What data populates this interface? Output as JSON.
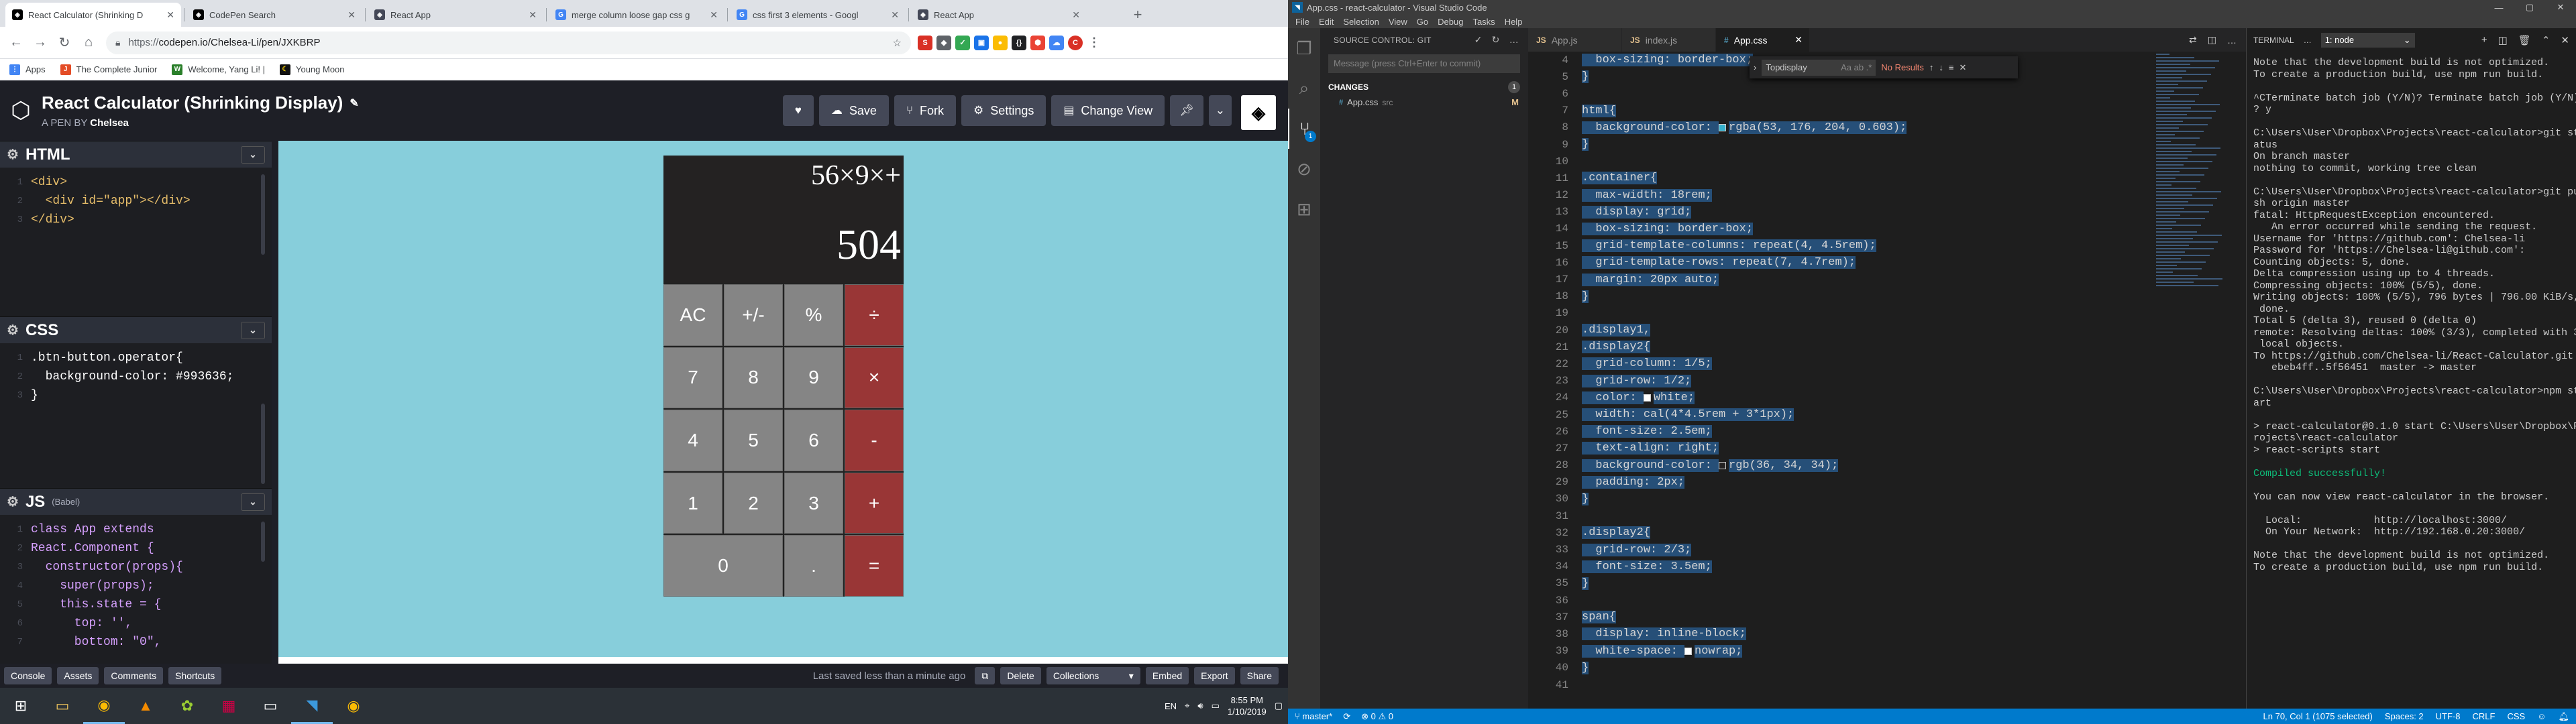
{
  "chrome": {
    "tabs": [
      {
        "title": "React Calculator (Shrinking D",
        "icon": "codepen-icon",
        "color": "#000000"
      },
      {
        "title": "CodePen Search",
        "icon": "codepen-icon",
        "color": "#000000"
      },
      {
        "title": "React App",
        "icon": "codepen-icon",
        "color": "#444857"
      },
      {
        "title": "merge column loose gap css g",
        "icon": "google-icon",
        "color": "#4285f4"
      },
      {
        "title": "css first 3 elements - Googl",
        "icon": "google-icon",
        "color": "#4285f4"
      },
      {
        "title": "React App",
        "icon": "codepen-icon",
        "color": "#444857"
      }
    ],
    "address": "https://codepen.io/Chelsea-Li/pen/JXKBRP",
    "address_domain": "https://",
    "address_rest": "codepen.io/Chelsea-Li/pen/JXKBRP",
    "bookmarks": [
      "Apps",
      "The Complete Junior",
      "Welcome, Yang Li! |",
      "Young Moon"
    ]
  },
  "codepen": {
    "title": "React Calculator (Shrinking Display)",
    "by_prefix": "A PEN BY",
    "author": "Chelsea",
    "buttons": {
      "save": "Save",
      "fork": "Fork",
      "settings": "Settings",
      "change_view": "Change View"
    },
    "html_label": "HTML",
    "css_label": "CSS",
    "js_label": "JS",
    "js_sub": "(Babel)",
    "html_lines": [
      "<div>",
      "  <div id=\"app\"></div>",
      "</div>"
    ],
    "css_lines": [
      ".btn-button.operator{",
      "  background-color: #993636;",
      "}"
    ],
    "js_lines": [
      "class App extends",
      "React.Component {",
      "  constructor(props){",
      "    super(props);",
      "    this.state = {",
      "      top: '',",
      "      bottom: \"0\","
    ],
    "calc": {
      "display_top": "56×9×+",
      "display_bottom": "504",
      "keys": [
        {
          "l": "AC",
          "op": false
        },
        {
          "l": "+/-",
          "op": false
        },
        {
          "l": "%",
          "op": false
        },
        {
          "l": "÷",
          "op": true
        },
        {
          "l": "7",
          "op": false
        },
        {
          "l": "8",
          "op": false
        },
        {
          "l": "9",
          "op": false
        },
        {
          "l": "×",
          "op": true
        },
        {
          "l": "4",
          "op": false
        },
        {
          "l": "5",
          "op": false
        },
        {
          "l": "6",
          "op": false
        },
        {
          "l": "-",
          "op": true
        },
        {
          "l": "1",
          "op": false
        },
        {
          "l": "2",
          "op": false
        },
        {
          "l": "3",
          "op": false
        },
        {
          "l": "+",
          "op": true
        },
        {
          "l": "0",
          "op": false
        },
        {
          "l": ".",
          "op": false
        },
        {
          "l": "=",
          "op": true
        }
      ]
    },
    "footer": {
      "console": "Console",
      "assets": "Assets",
      "comments": "Comments",
      "shortcuts": "Shortcuts",
      "saved": "Last saved less than a minute ago",
      "delete": "Delete",
      "collections": "Collections",
      "embed": "Embed",
      "export": "Export",
      "share": "Share"
    }
  },
  "taskbar": {
    "lang": "EN",
    "time": "8:55 PM",
    "date": "1/10/2019"
  },
  "vscode": {
    "title": "App.css - react-calculator - Visual Studio Code",
    "menu": [
      "File",
      "Edit",
      "Selection",
      "View",
      "Go",
      "Debug",
      "Tasks",
      "Help"
    ],
    "scm": {
      "header": "SOURCE CONTROL: GIT",
      "placeholder": "Message (press Ctrl+Enter to commit)",
      "changes": "CHANGES",
      "count": "1",
      "file": "App.css",
      "dir": "src",
      "status": "M"
    },
    "tabs": [
      "App.js",
      "index.js",
      "App.css"
    ],
    "find": {
      "value": "Topdisplay",
      "result": "No Results"
    },
    "code": [
      {
        "n": "4",
        "t": "  box-sizing: border-box;"
      },
      {
        "n": "5",
        "t": "}"
      },
      {
        "n": "6",
        "t": ""
      },
      {
        "n": "7",
        "t": "html{"
      },
      {
        "n": "8",
        "t": "  background-color: rgba(53, 176, 204, 0.603);"
      },
      {
        "n": "9",
        "t": "}"
      },
      {
        "n": "10",
        "t": ""
      },
      {
        "n": "11",
        "t": ".container{"
      },
      {
        "n": "12",
        "t": "  max-width: 18rem;"
      },
      {
        "n": "13",
        "t": "  display: grid;"
      },
      {
        "n": "14",
        "t": "  box-sizing: border-box;"
      },
      {
        "n": "15",
        "t": "  grid-template-columns: repeat(4, 4.5rem);"
      },
      {
        "n": "16",
        "t": "  grid-template-rows: repeat(7, 4.7rem);"
      },
      {
        "n": "17",
        "t": "  margin: 20px auto;"
      },
      {
        "n": "18",
        "t": "}"
      },
      {
        "n": "19",
        "t": ""
      },
      {
        "n": "20",
        "t": ".display1,"
      },
      {
        "n": "21",
        "t": ".display2{"
      },
      {
        "n": "22",
        "t": "  grid-column: 1/5;"
      },
      {
        "n": "23",
        "t": "  grid-row: 1/2;"
      },
      {
        "n": "24",
        "t": "  color: white;"
      },
      {
        "n": "25",
        "t": "  width: cal(4*4.5rem + 3*1px);"
      },
      {
        "n": "26",
        "t": "  font-size: 2.5em;"
      },
      {
        "n": "27",
        "t": "  text-align: right;"
      },
      {
        "n": "28",
        "t": "  background-color: rgb(36, 34, 34);"
      },
      {
        "n": "29",
        "t": "  padding: 2px;"
      },
      {
        "n": "30",
        "t": "}"
      },
      {
        "n": "31",
        "t": ""
      },
      {
        "n": "32",
        "t": ".display2{"
      },
      {
        "n": "33",
        "t": "  grid-row: 2/3;"
      },
      {
        "n": "34",
        "t": "  font-size: 3.5em;"
      },
      {
        "n": "35",
        "t": "}"
      },
      {
        "n": "36",
        "t": ""
      },
      {
        "n": "37",
        "t": "span{"
      },
      {
        "n": "38",
        "t": "  display: inline-block;"
      },
      {
        "n": "39",
        "t": "  white-space: nowrap;"
      },
      {
        "n": "40",
        "t": "}"
      },
      {
        "n": "41",
        "t": ""
      }
    ],
    "terminal": {
      "label": "TERMINAL",
      "select": "1: node",
      "lines": [
        "Note that the development build is not optimized.",
        "To create a production build, use npm run build.",
        "",
        "^CTerminate batch job (Y/N)? Terminate batch job (Y/N)",
        "? y",
        "",
        "C:\\Users\\User\\Dropbox\\Projects\\react-calculator>git st",
        "atus",
        "On branch master",
        "nothing to commit, working tree clean",
        "",
        "C:\\Users\\User\\Dropbox\\Projects\\react-calculator>git pu",
        "sh origin master",
        "fatal: HttpRequestException encountered.",
        "   An error occurred while sending the request.",
        "Username for 'https://github.com': Chelsea-li",
        "Password for 'https://Chelsea-li@github.com':",
        "Counting objects: 5, done.",
        "Delta compression using up to 4 threads.",
        "Compressing objects: 100% (5/5), done.",
        "Writing objects: 100% (5/5), 796 bytes | 796.00 KiB/s,",
        " done.",
        "Total 5 (delta 3), reused 0 (delta 0)",
        "remote: Resolving deltas: 100% (3/3), completed with 3",
        " local objects.",
        "To https://github.com/Chelsea-li/React-Calculator.git",
        "   ebeb4ff..5f56451  master -> master",
        "",
        "C:\\Users\\User\\Dropbox\\Projects\\react-calculator>npm st",
        "art",
        "",
        "> react-calculator@0.1.0 start C:\\Users\\User\\Dropbox\\P",
        "rojects\\react-calculator",
        "> react-scripts start",
        "",
        "Compiled successfully!",
        "",
        "You can now view react-calculator in the browser.",
        "",
        "  Local:            http://localhost:3000/",
        "  On Your Network:  http://192.168.0.20:3000/",
        "",
        "Note that the development build is not optimized.",
        "To create a production build, use npm run build."
      ]
    },
    "status": {
      "branch": "master*",
      "sync": "⟳",
      "errors": "⊗ 0 ⚠ 0",
      "pos": "Ln 70, Col 1 (1075 selected)",
      "spaces": "Spaces: 2",
      "enc": "UTF-8",
      "eol": "CRLF",
      "lang": "CSS"
    }
  }
}
